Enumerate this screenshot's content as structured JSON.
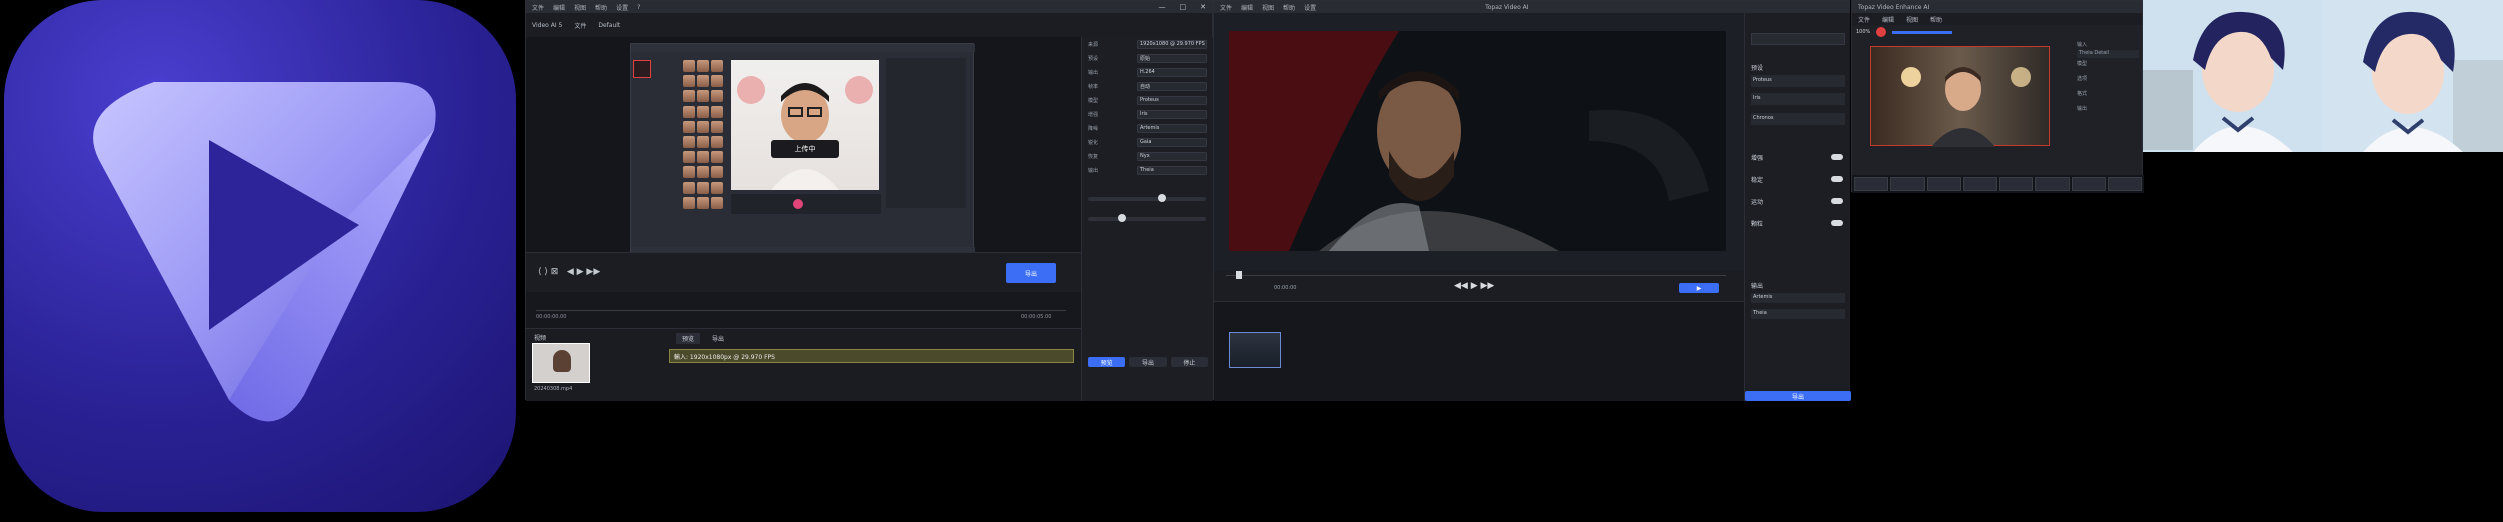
{
  "window1": {
    "menu": [
      "文件",
      "编辑",
      "视图",
      "帮助",
      "设置",
      "?"
    ],
    "title": "",
    "controls": [
      "—",
      "□",
      "✕"
    ],
    "tabs": [
      "Video AI 5",
      "文件",
      "Default"
    ],
    "preview_caption": "上传中",
    "export_button": "导出",
    "timeline_left": "00:00:00.00",
    "timeline_right": "00:00:05.00",
    "media_label": "视频",
    "clip_label": "20240308.mp4",
    "track_tabs": [
      "预览",
      "导出"
    ],
    "track_clip": "輸入: 1920x1080px @ 29.970 FPS",
    "right_panel": {
      "rows": [
        "来源",
        "预设",
        "输出",
        "帧率",
        "模型",
        "增强",
        "降噪",
        "锐化",
        "恢复",
        "输出"
      ],
      "values": [
        "1920x1080 @ 29.970 FPS",
        "原始",
        "H.264",
        "自动",
        "Proteus",
        "Iris",
        "Artemis",
        "Gaia",
        "Nyx",
        "Theia"
      ],
      "status": "1920x1080px @ 29.970 FPS",
      "buttons": [
        "预览",
        "导出",
        "停止"
      ]
    }
  },
  "window2": {
    "title": "Topaz Video AI",
    "menu": [
      "文件",
      "编辑",
      "视图",
      "帮助",
      "设置"
    ],
    "timecode": "00:00:00",
    "right_panel": {
      "sections": [
        "预设",
        "增强",
        "稳定",
        "运动",
        "颗粒",
        "输出"
      ],
      "items": [
        "Proteus",
        "Iris",
        "Chronos",
        "Artemis",
        "Theia"
      ],
      "button": "导出"
    }
  },
  "window3": {
    "title": "Topaz Video Enhance AI",
    "menu": [
      "文件",
      "编辑",
      "视图",
      "帮助"
    ],
    "zoom": "100%",
    "right_panel": {
      "rows": [
        "输入",
        "模型",
        "选项",
        "格式",
        "输出"
      ],
      "preset": "Theia Detail"
    }
  },
  "colors": {
    "accent": "#3b6ef5",
    "logo_bg": "#2a2296",
    "logo_shape": "#8f8cf2",
    "panel": "#1e2027"
  }
}
